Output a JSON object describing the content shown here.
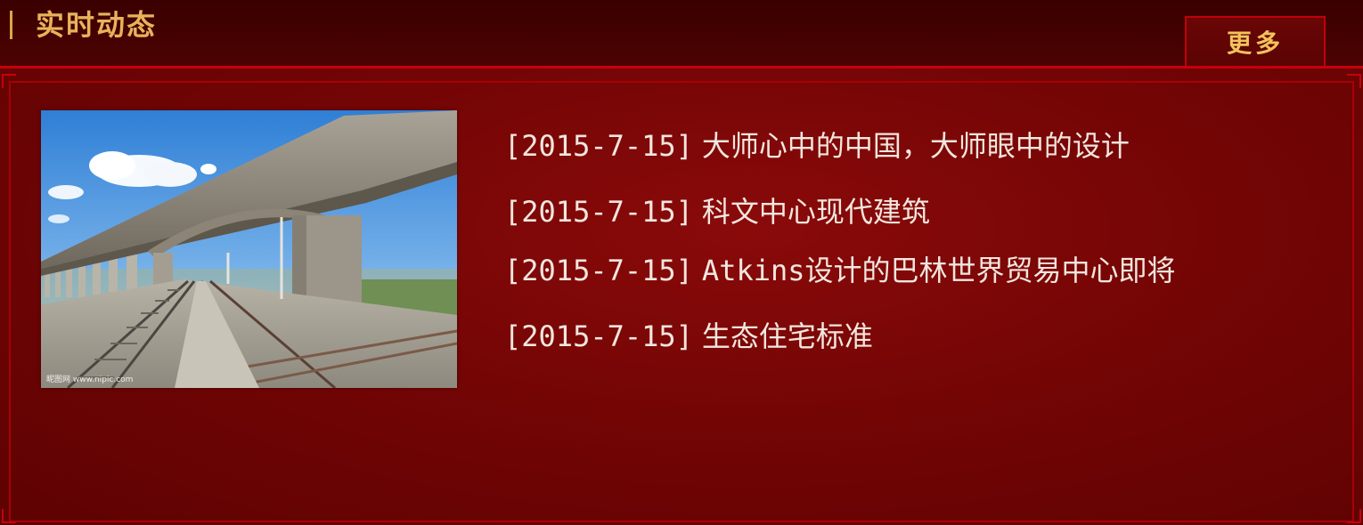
{
  "header": {
    "title": "实时动态",
    "more_label": "更多"
  },
  "photo": {
    "watermark": "昵图网 www.nipic.com"
  },
  "news": [
    {
      "date": "[2015-7-15]",
      "title": "大师心中的中国，大师眼中的设计"
    },
    {
      "date": "[2015-7-15]",
      "title": "科文中心现代建筑"
    },
    {
      "date": "[2015-7-15]",
      "title": "Atkins设计的巴林世界贸易中心即将"
    },
    {
      "date": "[2015-7-15]",
      "title": "生态住宅标准"
    }
  ],
  "colors": {
    "background": "#5c0000",
    "accent_gold": "#e9b25a",
    "border_red": "#c8000c",
    "text": "#f2e6de"
  }
}
